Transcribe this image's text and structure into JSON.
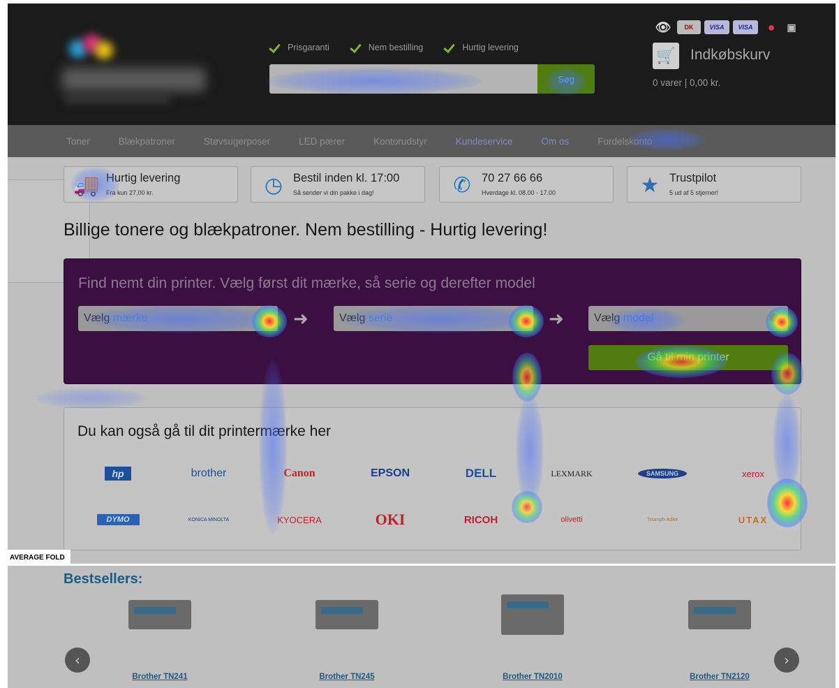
{
  "header": {
    "usps": [
      "Prisgaranti",
      "Nem bestilling",
      "Hurtig levering"
    ],
    "search": {
      "placeholder": "",
      "button_label": "Søg"
    },
    "cart": {
      "title": "Indkøbskurv",
      "summary": "0 varer | 0,00 kr."
    },
    "payment_icons": [
      "eye-icon",
      "dankort-icon",
      "visa-icon",
      "visa-electron-icon",
      "mastercard-icon",
      "other-card-icon"
    ]
  },
  "nav": {
    "items": [
      "Toner",
      "Blækpatroner",
      "Støvsugerposer",
      "LED pærer",
      "Kontorudstyr",
      "Kundeservice",
      "Om os",
      "Fordelskonto"
    ]
  },
  "info_boxes": [
    {
      "title": "Hurtig levering",
      "subtitle": "Fra kun 27,00 kr.",
      "icon": "truck-icon"
    },
    {
      "title": "Bestil inden kl. 17:00",
      "subtitle": "Så sender vi din pakke i dag!",
      "icon": "clock-icon"
    },
    {
      "title": "70 27 66 66",
      "subtitle": "Hverdage kl. 08.00 - 17.00",
      "icon": "phone-icon"
    },
    {
      "title": "Trustpilot",
      "subtitle": "5 ud af 5 stjerner!",
      "icon": "star-icon"
    }
  ],
  "headline": "Billige tonere og blækpatroner. Nem bestilling - Hurtig levering!",
  "printer_finder": {
    "title": "Find nemt din printer. Vælg først dit mærke, så serie og derefter model",
    "brand_select": {
      "prefix": "Vælg",
      "word": "mærke"
    },
    "series_select": {
      "prefix": "Vælg",
      "word": "serie"
    },
    "model_select": {
      "prefix": "Vælg",
      "word": "model"
    },
    "go_button": "Gå til min printer"
  },
  "brands": {
    "title": "Du kan også gå til dit printermærke her",
    "row1": [
      "hp",
      "brother",
      "Canon",
      "EPSON",
      "DELL",
      "LEXMARK",
      "SAMSUNG",
      "xerox"
    ],
    "row2": [
      "DYMO",
      "KONICA MINOLTA",
      "KYOCERA",
      "OKI",
      "RICOH",
      "olivetti",
      "Triumph-Adler",
      "UTAX"
    ]
  },
  "fold_label": "AVERAGE FOLD",
  "bestsellers": {
    "title": "Bestsellers:",
    "products": [
      "Brother TN241",
      "Brother TN245",
      "Brother TN2010",
      "Brother TN2120"
    ]
  },
  "colors": {
    "header_bg": "#1b1b1b",
    "nav_bg": "#5a5a5a",
    "finder_bg": "#3c0f42",
    "accent_green": "#4f7d10",
    "link_blue": "#1b5c85"
  }
}
